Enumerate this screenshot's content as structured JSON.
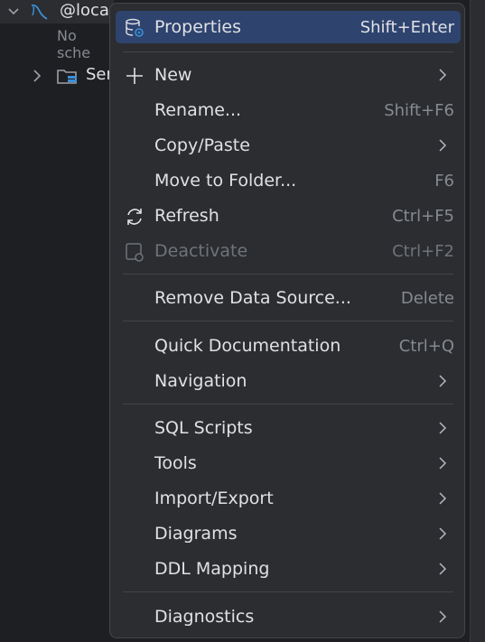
{
  "tree": {
    "datasource_label": "@loca",
    "no_schemas_label": "No sche",
    "server_label": "Ser"
  },
  "menu": {
    "items": [
      {
        "label": "Properties",
        "shortcut": "Shift+Enter"
      },
      {
        "label": "New"
      },
      {
        "label": "Rename...",
        "shortcut": "Shift+F6"
      },
      {
        "label": "Copy/Paste"
      },
      {
        "label": "Move to Folder...",
        "shortcut": "F6"
      },
      {
        "label": "Refresh",
        "shortcut": "Ctrl+F5"
      },
      {
        "label": "Deactivate",
        "shortcut": "Ctrl+F2"
      },
      {
        "label": "Remove Data Source...",
        "shortcut": "Delete"
      },
      {
        "label": "Quick Documentation",
        "shortcut": "Ctrl+Q"
      },
      {
        "label": "Navigation"
      },
      {
        "label": "SQL Scripts"
      },
      {
        "label": "Tools"
      },
      {
        "label": "Import/Export"
      },
      {
        "label": "Diagrams"
      },
      {
        "label": "DDL Mapping"
      },
      {
        "label": "Diagnostics"
      }
    ]
  },
  "colors": {
    "selection": "#2e436e",
    "menu_bg": "#2b2d30",
    "text": "#dfe1e5",
    "shortcut": "#868a91",
    "disabled": "#6f737a"
  }
}
